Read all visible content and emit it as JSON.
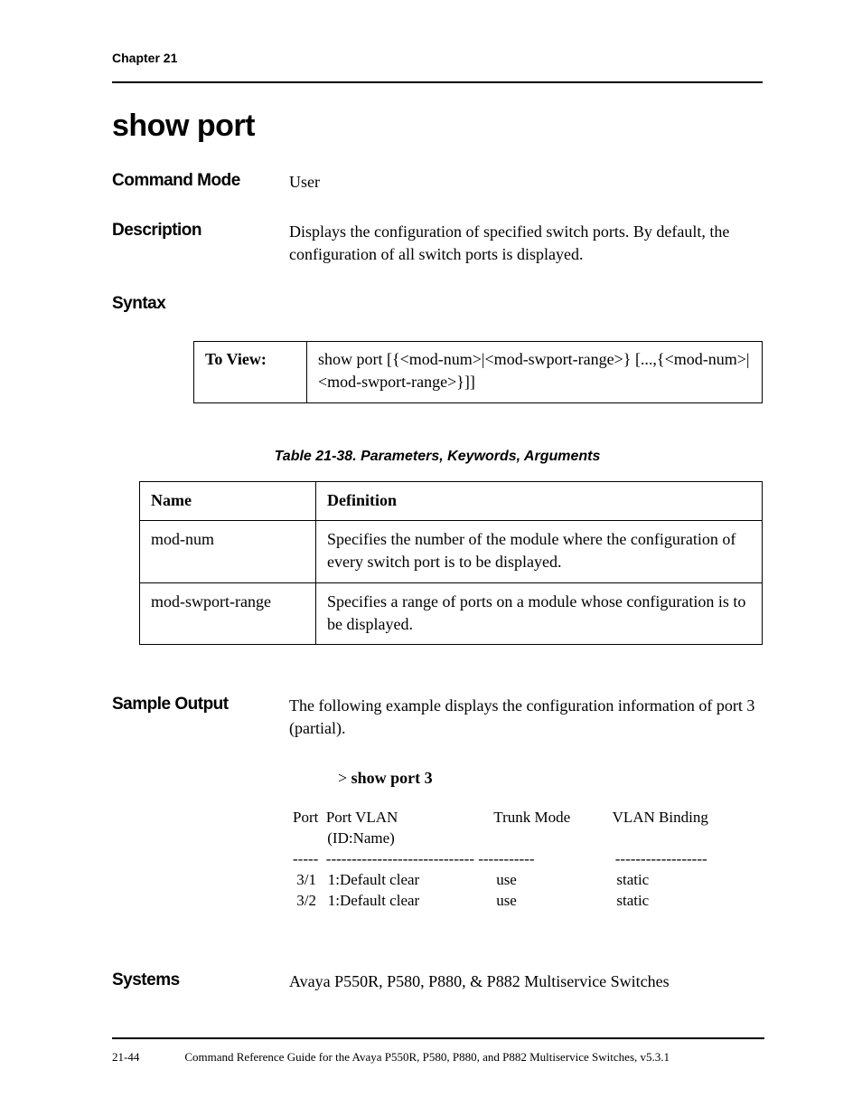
{
  "header": {
    "chapter": "Chapter 21"
  },
  "title": "show port",
  "rows": {
    "command_mode": {
      "label": "Command Mode",
      "value": "User"
    },
    "description": {
      "label": "Description",
      "value": "Displays the configuration of specified switch ports. By default, the configuration of all switch ports is displayed."
    },
    "syntax": {
      "label": "Syntax"
    },
    "sample_output": {
      "label": "Sample Output",
      "value": "The following example displays the configuration information of port 3 (partial)."
    },
    "systems": {
      "label": "Systems",
      "value": "Avaya P550R, P580, P880, & P882 Multiservice Switches"
    }
  },
  "syntax_table": {
    "header": "To View:",
    "body": "show port [{<mod-num>|<mod-swport-range>} [...,{<mod-num>|<mod-swport-range>}]]"
  },
  "params_caption": "Table 21-38.  Parameters, Keywords, Arguments",
  "params_table": {
    "headers": {
      "name": "Name",
      "definition": "Definition"
    },
    "rows": [
      {
        "name": "mod-num",
        "definition": "Specifies the number of the module where the configuration of every switch port is to be displayed."
      },
      {
        "name": "mod-swport-range",
        "definition": "Specifies a range of ports on a module whose configuration is to be displayed."
      }
    ]
  },
  "sample_prompt": {
    "gt": "> ",
    "cmd": "show port 3"
  },
  "sample_output_text": "Port  Port VLAN                         Trunk Mode           VLAN Binding\n         (ID:Name)\n-----  ----------------------------- -----------                     ------------------\n 3/1   1:Default clear                    use                          static\n 3/2   1:Default clear                    use                          static",
  "footer": {
    "page": "21-44",
    "text": "Command Reference Guide for the Avaya P550R, P580, P880, and P882 Multiservice Switches, v5.3.1"
  }
}
